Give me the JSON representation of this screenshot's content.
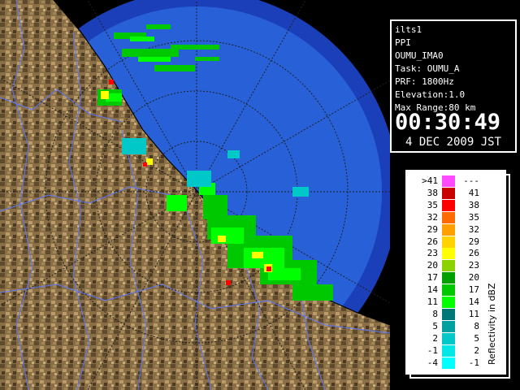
{
  "info": {
    "site": "ilts1",
    "scan_mode": "PPI",
    "product": "OUMU_IMA0",
    "task": "Task: OUMU_A",
    "prf": "PRF: 1800Hz",
    "elevation": "Elevation:1.0",
    "max_range": "Max Range:80 km",
    "time": "00:30:49",
    "date": "4 DEC 2009 JST"
  },
  "legend": {
    "unit": "Reflectivity in dBZ",
    "bins": [
      {
        "lo": ">41",
        "hi": "---",
        "color": "#ff4aff"
      },
      {
        "lo": "38",
        "hi": "41",
        "color": "#c80000"
      },
      {
        "lo": "35",
        "hi": "38",
        "color": "#ff0000"
      },
      {
        "lo": "32",
        "hi": "35",
        "color": "#ff6a00"
      },
      {
        "lo": "29",
        "hi": "32",
        "color": "#ffa000"
      },
      {
        "lo": "26",
        "hi": "29",
        "color": "#ffd200"
      },
      {
        "lo": "23",
        "hi": "26",
        "color": "#ffff00"
      },
      {
        "lo": "20",
        "hi": "23",
        "color": "#8cd200"
      },
      {
        "lo": "17",
        "hi": "20",
        "color": "#00a000"
      },
      {
        "lo": "14",
        "hi": "17",
        "color": "#00c800"
      },
      {
        "lo": "11",
        "hi": "14",
        "color": "#00ff00"
      },
      {
        "lo": "8",
        "hi": "11",
        "color": "#007878"
      },
      {
        "lo": "5",
        "hi": "8",
        "color": "#00a0a0"
      },
      {
        "lo": "2",
        "hi": "5",
        "color": "#00c8c8"
      },
      {
        "lo": "-1",
        "hi": "2",
        "color": "#00e6e6"
      },
      {
        "lo": "-4",
        "hi": "-1",
        "color": "#00ffff"
      }
    ]
  },
  "colors": {
    "background": "#000000",
    "sea_inner": "#1f6be0",
    "sea_outer": "#2860d8",
    "sea_beyond_range": "#1a3fb8",
    "land": "#8a6e45",
    "border_lines": "#5a78ff",
    "range_rings": "#202020"
  }
}
